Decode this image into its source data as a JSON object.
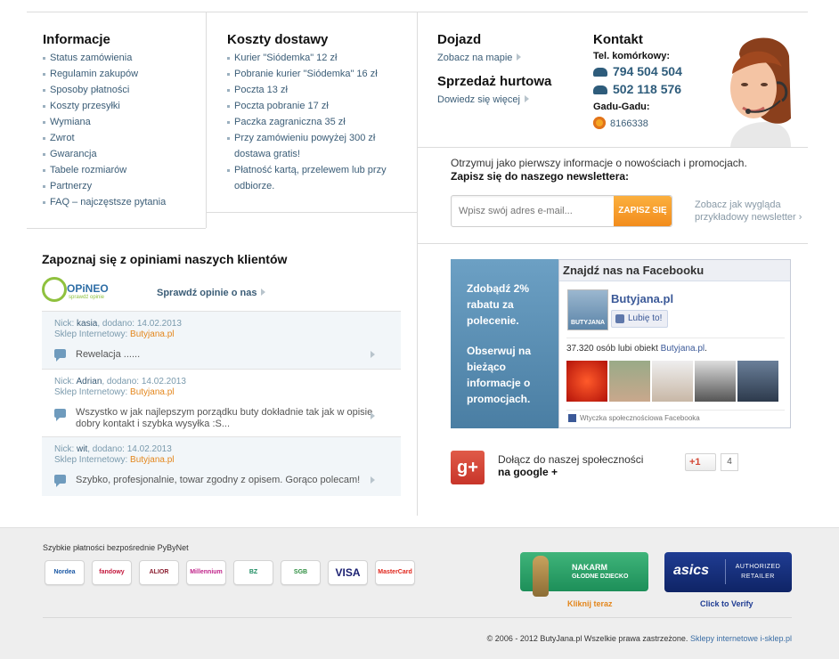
{
  "info": {
    "title": "Informacje",
    "links": [
      "Status zamówienia",
      "Regulamin zakupów",
      "Sposoby płatności",
      "Koszty przesyłki",
      "Wymiana",
      "Zwrot",
      "Gwarancja",
      "Tabele rozmiarów",
      "Partnerzy",
      "FAQ – najczęstsze pytania"
    ]
  },
  "shipping": {
    "title": "Koszty dostawy",
    "items": [
      "Kurier \"Siódemka\" 12 zł",
      "Pobranie kurier \"Siódemka\" 16 zł",
      "Poczta 13 zł",
      "Poczta pobranie 17 zł",
      "Paczka zagraniczna 35 zł",
      "Przy zamówieniu powyżej 300 zł dostawa gratis!",
      "Płatność kartą, przelewem lub przy odbiorze."
    ]
  },
  "directions": {
    "title": "Dojazd",
    "link": "Zobacz na mapie"
  },
  "wholesale": {
    "title": "Sprzedaż hurtowa",
    "link": "Dowiedz się więcej"
  },
  "contact": {
    "title": "Kontakt",
    "mobile_label": "Tel. komórkowy:",
    "phone1": "794 504 504",
    "phone2": "502 118 576",
    "gg_label": "Gadu-Gadu:",
    "gg_number": "8166338"
  },
  "newsletter": {
    "line1": "Otrzymuj jako pierwszy informacje o nowościach i promocjach.",
    "line2": "Zapisz się do naszego newslettera:",
    "placeholder": "Wpisz swój adres e-mail...",
    "button": "ZAPISZ SIĘ",
    "sample": "Zobacz jak wygląda przykładowy newsletter ›"
  },
  "reviews": {
    "title": "Zapoznaj się z opiniami naszych klientów",
    "logo_text": "OPiNEO",
    "logo_sub": "sprawdź opinie",
    "check_link": "Sprawdź opinie o nas",
    "nick_label": "Nick:",
    "added_label": ", dodano:",
    "shop_label": "Sklep Internetowy:",
    "items": [
      {
        "nick": "kasia",
        "date": "14.02.2013",
        "shop": "Butyjana.pl",
        "text": "Rewelacja ......"
      },
      {
        "nick": "Adrian",
        "date": "14.02.2013",
        "shop": "Butyjana.pl",
        "text": "Wszystko w jak najlepszym porządku buty dokładnie tak jak w opisie dobry kontakt i szybka wysyłka :S..."
      },
      {
        "nick": "wit",
        "date": "14.02.2013",
        "shop": "Butyjana.pl",
        "text": "Szybko, profesjonalnie, towar zgodny z opisem. Gorąco polecam!"
      }
    ]
  },
  "promo": {
    "text1": "Zdobądź 2% rabatu za polecenie.",
    "text2": "Obserwuj na bieżąco informacje o promocjach."
  },
  "facebook": {
    "title": "Znajdź nas na Facebooku",
    "page_name": "Butyjana.pl",
    "avatar_text": "BUTYJANA",
    "like_button": "Lubię to!",
    "likes_count": "37.320",
    "likes_text": "osób lubi obiekt",
    "likes_page": "Butyjana.pl",
    "plugin_note": "Wtyczka społecznościowa Facebooka"
  },
  "google": {
    "line1": "Dołącz do naszej społeczności",
    "line2": "na google +",
    "plus_label": "+1",
    "count": "4"
  },
  "footer": {
    "payments_title": "Szybkie płatności bezpośrednie PyByNet",
    "banks": [
      "Nordea",
      "fandowy",
      "ALIOR BANK",
      "Millennium",
      "BZ",
      "SGB",
      "VISA",
      "MasterCard"
    ],
    "pajacyk_line1": "NAKARM",
    "pajacyk_line2": "GŁODNE DZIECKO",
    "pajacyk_cta": "Kliknij teraz",
    "asics_brand": "asics",
    "asics_badge": "AUTHORIZED RETAILER",
    "asics_cta": "Click to Verify",
    "copyright": "© 2006 - 2012 ButyJana.pl Wszelkie prawa zastrzeżone.",
    "credit_link": "Sklepy internetowe i-sklep.pl"
  },
  "colors": {
    "link": "#3b5d77",
    "accent_orange": "#f59a2f",
    "promo_blue": "#5b8fb2",
    "fb_blue": "#3b5998",
    "google_red": "#d34836"
  }
}
